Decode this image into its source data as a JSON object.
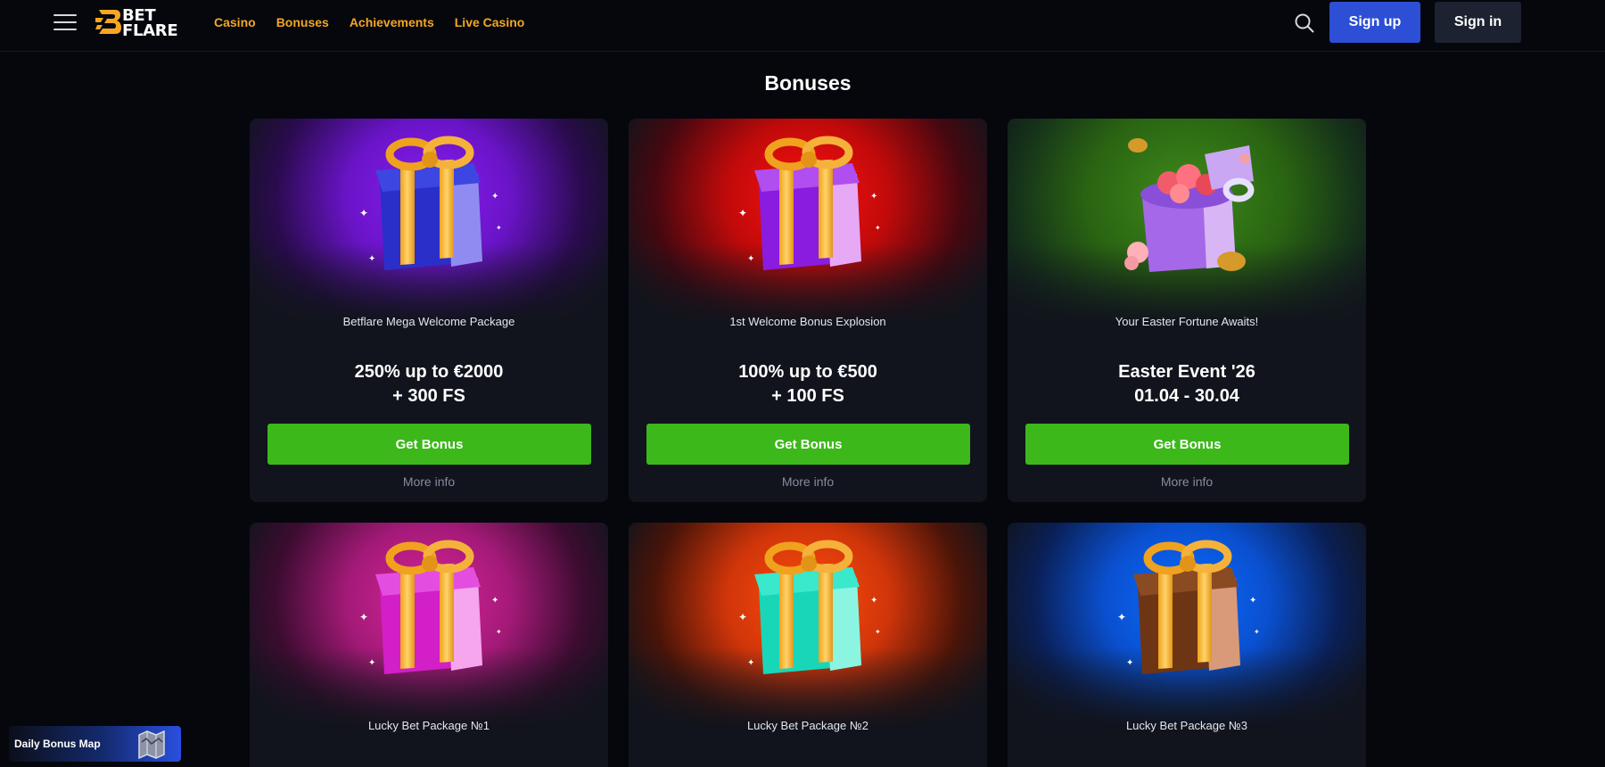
{
  "header": {
    "logo_text_line1": "BET",
    "logo_text_line2": "FLARE",
    "nav": [
      {
        "label": "Casino"
      },
      {
        "label": "Bonuses"
      },
      {
        "label": "Achievements"
      },
      {
        "label": "Live Casino"
      }
    ],
    "signup_label": "Sign up",
    "signin_label": "Sign in",
    "icons": {
      "menu": "hamburger-menu-icon",
      "search": "search-icon"
    }
  },
  "page": {
    "title": "Bonuses"
  },
  "cards": [
    {
      "subtitle": "Betflare Mega Welcome Package",
      "headline_line1": "250% up to €2000",
      "headline_line2": "+ 300 FS",
      "button_label": "Get Bonus",
      "more_info_label": "More info",
      "art_color": "#8a1cf0",
      "gift": "blue-gift-box"
    },
    {
      "subtitle": "1st Welcome Bonus Explosion",
      "headline_line1": "100% up to €500",
      "headline_line2": "+ 100 FS",
      "button_label": "Get Bonus",
      "more_info_label": "More info",
      "art_color": "#ff1010",
      "gift": "purple-gift-box"
    },
    {
      "subtitle": "Your Easter Fortune Awaits!",
      "headline_line1": "Easter Event '26",
      "headline_line2": "01.04 - 30.04",
      "button_label": "Get Bonus",
      "more_info_label": "More info",
      "art_color": "#3e8a1c",
      "gift": "easter-gift-box-with-roses"
    },
    {
      "subtitle": "Lucky Bet Package №1",
      "art_color": "#d9249a",
      "gift": "pink-gift-box"
    },
    {
      "subtitle": "Lucky Bet Package №2",
      "art_color": "#ff4d0a",
      "gift": "turquoise-gift-box"
    },
    {
      "subtitle": "Lucky Bet Package №3",
      "art_color": "#0a6cff",
      "gift": "brown-gift-box"
    }
  ],
  "daily_bonus_map": {
    "label": "Daily Bonus Map",
    "icon": "map-icon"
  },
  "colors": {
    "background": "#05070d",
    "card": "#11141c",
    "nav_accent": "#f5a623",
    "signup": "#2c4fd6",
    "signin": "#1c2230",
    "get_bonus": "#3cb81b"
  }
}
